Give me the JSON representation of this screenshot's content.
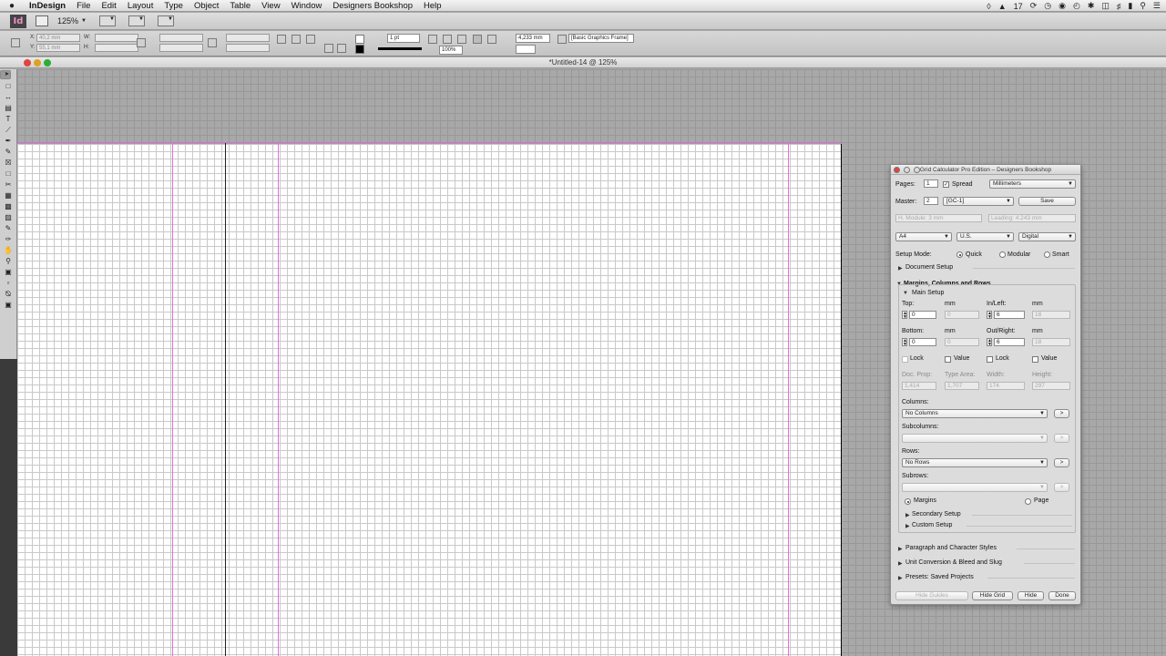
{
  "menubar": {
    "apple": "",
    "items": [
      "InDesign",
      "File",
      "Edit",
      "Layout",
      "Type",
      "Object",
      "Table",
      "View",
      "Window",
      "Designers Bookshop",
      "Help"
    ],
    "status_number": "17"
  },
  "appbar": {
    "logo": "Id",
    "zoom": "125%"
  },
  "control": {
    "x_value": "40,2 mm",
    "y_value": "55,1 mm",
    "stroke_weight": "1 pt",
    "ref_value": "4,233 mm",
    "scale": "100%",
    "style": "[Basic Graphics Frame]"
  },
  "document": {
    "title": "*Untitled-14 @ 125%"
  },
  "panel": {
    "title": "Grid Calculator Pro Edition – Designers Bookshop",
    "pages_label": "Pages:",
    "pages_value": "1",
    "spread_label": "Spread",
    "units": "Millimeters",
    "master_label": "Master:",
    "master_value": "2",
    "master_select": "[GC-1]",
    "save": "Save",
    "h_module": "H. Module: 3 mm",
    "leading": "Leading: 4.243 mm",
    "size": "A4",
    "region": "U.S.",
    "output": "Digital",
    "setup_mode_label": "Setup Mode:",
    "modes": [
      "Quick",
      "Modular",
      "Smart"
    ],
    "document_setup": "Document Setup",
    "mcr": "Margins, Columns and Rows",
    "main_setup": "Main Setup",
    "top_label": "Top:",
    "mm": "mm",
    "top_value": "0",
    "top_mm": "0",
    "inleft_label": "In/Left:",
    "inleft_value": "6",
    "inleft_mm": "18",
    "bottom_label": "Bottom:",
    "bottom_value": "0",
    "bottom_mm": "0",
    "outright_label": "Out/Right:",
    "outright_value": "6",
    "outright_mm": "18",
    "lock": "Lock",
    "value": "Value",
    "docprop_label": "Doc. Prop:",
    "typearea_label": "Type Area:",
    "width_label": "Width:",
    "height_label": "Height:",
    "docprop": "1,414",
    "typearea": "1,707",
    "width": "174",
    "height": "297",
    "columns_label": "Columns:",
    "columns": "No Columns",
    "subcolumns_label": "Subcolumns:",
    "rows_label": "Rows:",
    "rows": "No Rows",
    "subrows_label": "Subrows:",
    "go": ">",
    "margins": "Margins",
    "page": "Page",
    "secondary": "Secondary Setup",
    "custom": "Custom Setup",
    "para": "Paragraph and Character Styles",
    "unit_conv": "Unit Conversion & Bleed and Slug",
    "presets": "Presets: Saved Projects",
    "hide_guides": "Hide Guides",
    "hide_grid": "Hide Grid",
    "hide": "Hide",
    "done": "Done"
  },
  "colors": {
    "guide_margin": "#e070e0",
    "guide_column": "#222222",
    "close": "#e0443e",
    "minimize": "#dea123",
    "zoom": "#2aae35"
  }
}
